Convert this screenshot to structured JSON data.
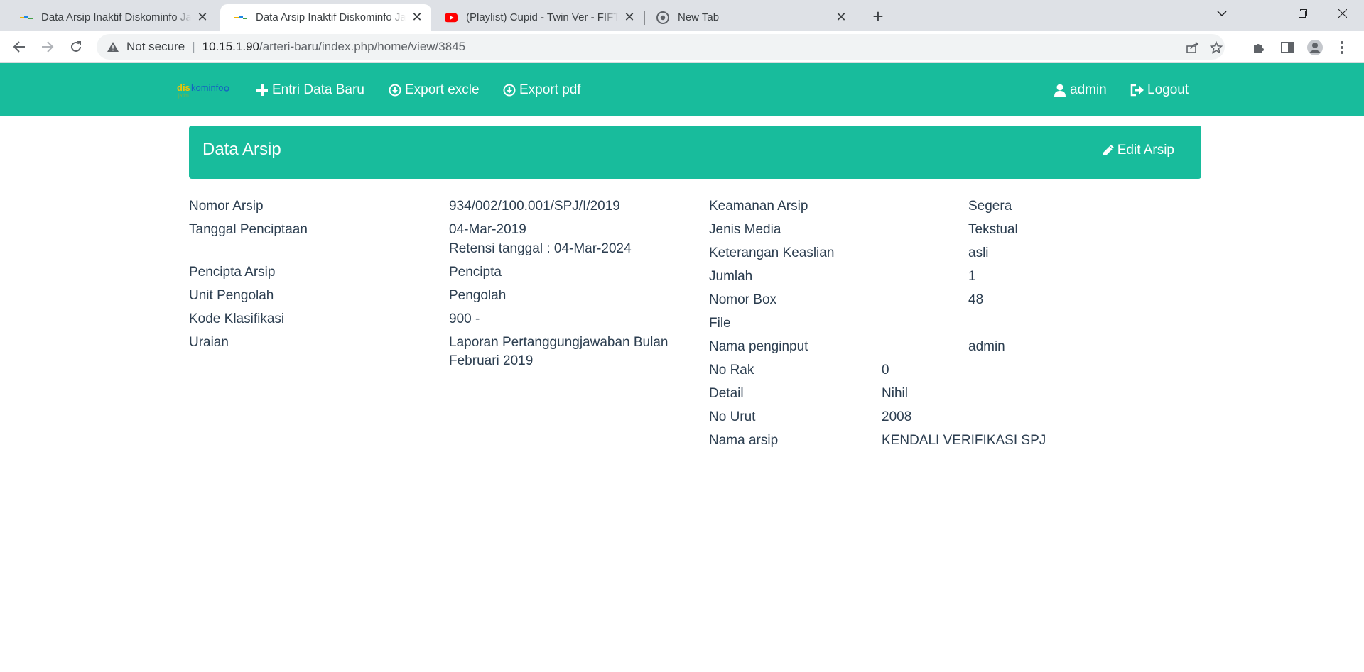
{
  "browser": {
    "tabs": [
      {
        "title": "Data Arsip Inaktif Diskominfo Jawa Timur",
        "active": false
      },
      {
        "title": "Data Arsip Inaktif Diskominfo Jawa Timur",
        "active": true
      },
      {
        "title": "(Playlist) Cupid - Twin Ver - FIFTY FIFTY",
        "active": false
      },
      {
        "title": "New Tab",
        "active": false
      }
    ],
    "security_label": "Not secure",
    "url_host": "10.15.1.90",
    "url_path": "/arteri-baru/index.php/home/view/3845"
  },
  "navbar": {
    "brand_text": "diskominfo",
    "entri_label": "Entri Data Baru",
    "export_excel_label": "Export excle",
    "export_pdf_label": "Export pdf",
    "user_label": "admin",
    "logout_label": "Logout"
  },
  "panel": {
    "title": "Data Arsip",
    "edit_label": "Edit Arsip"
  },
  "left_fields": [
    {
      "label": "Nomor Arsip",
      "value": "934/002/100.001/SPJ/I/2019"
    },
    {
      "label": "Tanggal Penciptaan",
      "value": "04-Mar-2019",
      "extra": "Retensi tanggal : 04-Mar-2024"
    },
    {
      "label": "Pencipta Arsip",
      "value": "Pencipta"
    },
    {
      "label": "Unit Pengolah",
      "value": "Pengolah"
    },
    {
      "label": "Kode Klasifikasi",
      "value": "900 -"
    },
    {
      "label": "Uraian",
      "value": "Laporan Pertanggungjawaban Bulan Februari 2019"
    }
  ],
  "right_fields": [
    {
      "label": "Keamanan Arsip",
      "value": "Segera"
    },
    {
      "label": "Jenis Media",
      "value": "Tekstual"
    },
    {
      "label": "Keterangan Keaslian",
      "value": "asli"
    },
    {
      "label": "Jumlah",
      "value": "1"
    },
    {
      "label": "Nomor Box",
      "value": "48"
    },
    {
      "label": "File",
      "value": ""
    },
    {
      "label": "Nama penginput",
      "value": "admin"
    }
  ],
  "extra_fields": [
    {
      "label": "No Rak",
      "value": "0"
    },
    {
      "label": "Detail",
      "value": "Nihil"
    },
    {
      "label": "No Urut",
      "value": "2008"
    },
    {
      "label": "Nama arsip",
      "value": "KENDALI VERIFIKASI SPJ"
    }
  ],
  "colors": {
    "accent": "#18bc9c",
    "text": "#2c3e50"
  }
}
